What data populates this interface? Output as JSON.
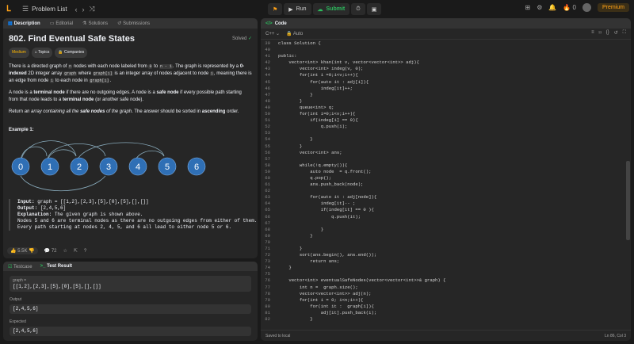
{
  "topbar": {
    "problem_list": "Problem List",
    "run": "Run",
    "submit": "Submit",
    "premium": "Premium",
    "streak": "0"
  },
  "left": {
    "tabs": [
      "Description",
      "Editorial",
      "Solutions",
      "Submissions"
    ],
    "title": "802. Find Eventual Safe States",
    "solved": "Solved",
    "chips": [
      "Medium",
      "Topics",
      "Companies"
    ],
    "p1a": "There is a directed graph of",
    "p1_n": "n",
    "p1b": "nodes with each node labeled from",
    "p1_0": "0",
    "p1c": "to",
    "p1_n1": "n - 1",
    "p1d": ". The graph is represented by a",
    "p1_bold": "0-indexed",
    "p1e": "2D integer array",
    "p1_graph": "graph",
    "p1f": "where",
    "p1_gi": "graph[i]",
    "p1g": "is an integer array of nodes adjacent to node",
    "p1_i": "i",
    "p1h": ", meaning there is an edge from node",
    "p1_i2": "i",
    "p1i": "to each node in",
    "p1_gi2": "graph[i]",
    "p1j": ".",
    "p2a": "A node is a",
    "p2b": "terminal node",
    "p2c": "if there are no outgoing edges. A node is a",
    "p2d": "safe node",
    "p2e": "if every possible path starting from that node leads to a",
    "p2f": "terminal node",
    "p2g": "(or another safe node).",
    "p3a": "Return",
    "p3b": "an array containing all the",
    "p3c": "safe nodes",
    "p3d": "of the graph",
    "p3e": ". The answer should be sorted in",
    "p3f": "ascending",
    "p3g": "order.",
    "example_title": "Example 1:",
    "nodes": [
      "0",
      "1",
      "2",
      "3",
      "4",
      "5",
      "6"
    ],
    "input_label": "Input:",
    "input": " graph = [[1,2],[2,3],[5],[0],[5],[],[]]",
    "output_label": "Output:",
    "output": " [2,4,5,6]",
    "expl_label": "Explanation:",
    "expl": " The given graph is shown above.",
    "expl2": "Nodes 5 and 6 are terminal nodes as there are no outgoing edges from either of them.",
    "expl3": "Every path starting at nodes 2, 4, 5, and 6 all lead to either node 5 or 6.",
    "likes": "5.5K",
    "comments": "72"
  },
  "bottom": {
    "tabs": [
      "Testcase",
      "Test Result"
    ],
    "graph_label": "graph =",
    "graph_val": "[[1,2],[2,3],[5],[0],[5],[],[]]",
    "output_label": "Output",
    "output_val": "[2,4,5,6]",
    "expected_label": "Expected",
    "expected_val": "[2,4,5,6]"
  },
  "code": {
    "tab": "Code",
    "lang": "C++",
    "auto": "Auto",
    "saved": "Saved to local",
    "pos": "Ln 86, Col 3",
    "lines": [
      [
        "39",
        "class Solution {"
      ],
      [
        "40",
        ""
      ],
      [
        "41",
        "public:"
      ],
      [
        "42",
        "    vector<int> khan(int v, vector<vector<int>> adj){"
      ],
      [
        "43",
        "        vector<int> indeg(v, 0);"
      ],
      [
        "44",
        "        for(int i =0;i<v;i++){"
      ],
      [
        "45",
        "            for(auto it : adj[i]){"
      ],
      [
        "46",
        "                indeg[it]++;"
      ],
      [
        "47",
        "            }"
      ],
      [
        "48",
        "        }"
      ],
      [
        "49",
        "        queue<int> q;"
      ],
      [
        "50",
        "        for(int i=0;i<v;i++){"
      ],
      [
        "51",
        "            if(indeg[i] == 0){"
      ],
      [
        "52",
        "                q.push(i);"
      ],
      [
        "53",
        ""
      ],
      [
        "54",
        "            }"
      ],
      [
        "55",
        "        }"
      ],
      [
        "56",
        "        vector<int> ans;"
      ],
      [
        "57",
        ""
      ],
      [
        "58",
        "        while(!q.empty()){"
      ],
      [
        "59",
        "            auto node  = q.front();"
      ],
      [
        "60",
        "            q.pop();"
      ],
      [
        "61",
        "            ans.push_back(node);"
      ],
      [
        "62",
        ""
      ],
      [
        "63",
        "            for(auto it : adj[node]){"
      ],
      [
        "64",
        "                indeg[it]-- ;"
      ],
      [
        "65",
        "                if(indeg[it] == 0 ){"
      ],
      [
        "66",
        "                    q.push(it);"
      ],
      [
        "67",
        ""
      ],
      [
        "68",
        "                }"
      ],
      [
        "69",
        "            }"
      ],
      [
        "70",
        ""
      ],
      [
        "71",
        "        }"
      ],
      [
        "72",
        "        sort(ans.begin(), ans.end());"
      ],
      [
        "73",
        "            return ans;"
      ],
      [
        "74",
        "    }"
      ],
      [
        "75",
        ""
      ],
      [
        "76",
        "    vector<int> eventualSafeNodes(vector<vector<int>>& graph) {"
      ],
      [
        "77",
        "        int n =  graph.size();"
      ],
      [
        "78",
        "        vector<vector<int>> adj(n);"
      ],
      [
        "79",
        "        for(int i = 0; i<n;i++){"
      ],
      [
        "80",
        "            for(int it :  graph[i]){"
      ],
      [
        "81",
        "                adj[it].push_back(i);"
      ],
      [
        "82",
        "            }"
      ]
    ]
  }
}
